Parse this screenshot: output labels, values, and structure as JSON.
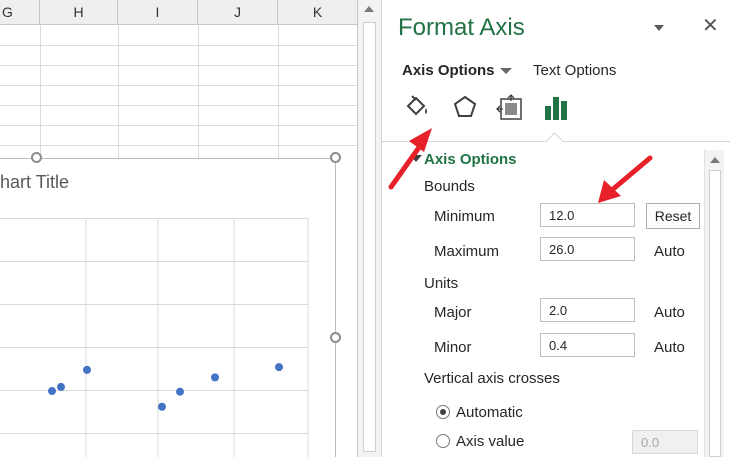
{
  "sheet": {
    "columns": [
      "G",
      "H",
      "I",
      "J",
      "K"
    ]
  },
  "chart": {
    "title": "hart Title",
    "chart_data": {
      "type": "scatter",
      "title": "hart Title",
      "series": [
        {
          "name": "",
          "points": [
            [
              1,
              18.0
            ],
            [
              2,
              18.6
            ],
            [
              3,
              21.1
            ],
            [
              4,
              15.7
            ],
            [
              5,
              17.9
            ],
            [
              6,
              20.0
            ],
            [
              7,
              21.5
            ]
          ]
        }
      ],
      "grid": true
    }
  },
  "pane": {
    "title": "Format Axis",
    "close_glyph": "✕",
    "tabs": [
      {
        "label": "Axis Options",
        "active": true
      },
      {
        "label": "Text Options",
        "active": false
      }
    ],
    "icons": [
      "fill-line-icon",
      "effects-icon",
      "size-properties-icon",
      "axis-options-icon"
    ],
    "section_title": "Axis Options",
    "bounds": {
      "heading": "Bounds",
      "minimum_label": "Minimum",
      "minimum_value": "12.0",
      "minimum_action": "Reset",
      "maximum_label": "Maximum",
      "maximum_value": "26.0",
      "maximum_action": "Auto"
    },
    "units": {
      "heading": "Units",
      "major_label": "Major",
      "major_value": "2.0",
      "major_action": "Auto",
      "minor_label": "Minor",
      "minor_value": "0.4",
      "minor_action": "Auto"
    },
    "vertical_axis_crosses": {
      "heading": "Vertical axis crosses",
      "automatic_label": "Automatic",
      "axis_value_label": "Axis value",
      "axis_value": "0.0",
      "selected": "Automatic"
    }
  },
  "colors": {
    "accent": "#217346",
    "marker": "#4472C4",
    "annotation": "#E8202A"
  }
}
